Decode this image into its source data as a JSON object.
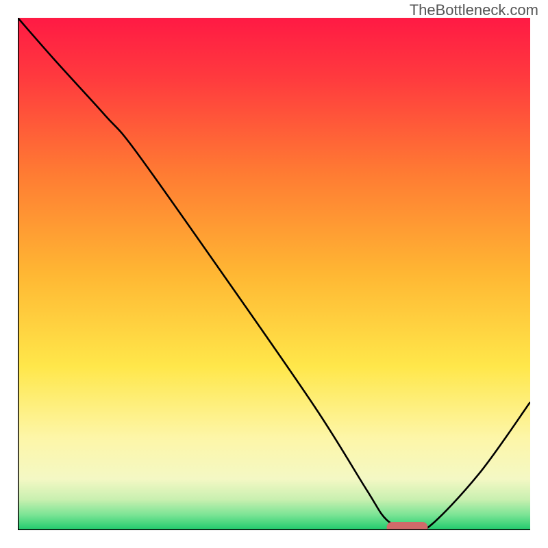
{
  "watermark": "TheBottleneck.com",
  "chart_data": {
    "type": "line",
    "title": "",
    "xlabel": "",
    "ylabel": "",
    "xlim": [
      0,
      100
    ],
    "ylim": [
      0,
      100
    ],
    "background_gradient": {
      "stops": [
        {
          "offset": 0,
          "color": "#ff1a44"
        },
        {
          "offset": 12,
          "color": "#ff3b3e"
        },
        {
          "offset": 30,
          "color": "#ff7a33"
        },
        {
          "offset": 50,
          "color": "#ffb733"
        },
        {
          "offset": 68,
          "color": "#ffe74a"
        },
        {
          "offset": 82,
          "color": "#fdf6a8"
        },
        {
          "offset": 90,
          "color": "#f4f8c4"
        },
        {
          "offset": 94,
          "color": "#c9f0b0"
        },
        {
          "offset": 97,
          "color": "#7be495"
        },
        {
          "offset": 100,
          "color": "#1ec96b"
        }
      ]
    },
    "series": [
      {
        "name": "bottleneck-curve",
        "color": "#000000",
        "x": [
          0,
          7,
          17,
          23,
          40,
          58,
          68,
          72,
          76,
          80,
          90,
          100
        ],
        "y": [
          100,
          92,
          81,
          74,
          50,
          24,
          8,
          2,
          0.5,
          0.5,
          11,
          25
        ]
      }
    ],
    "marker": {
      "name": "optimal-range",
      "color": "#d16a6a",
      "x_start": 72,
      "x_end": 80,
      "y": 0.5,
      "thickness": 2.2
    },
    "frame": {
      "left": true,
      "bottom": true,
      "right": false,
      "top": false,
      "color": "#000000",
      "width": 3
    }
  }
}
